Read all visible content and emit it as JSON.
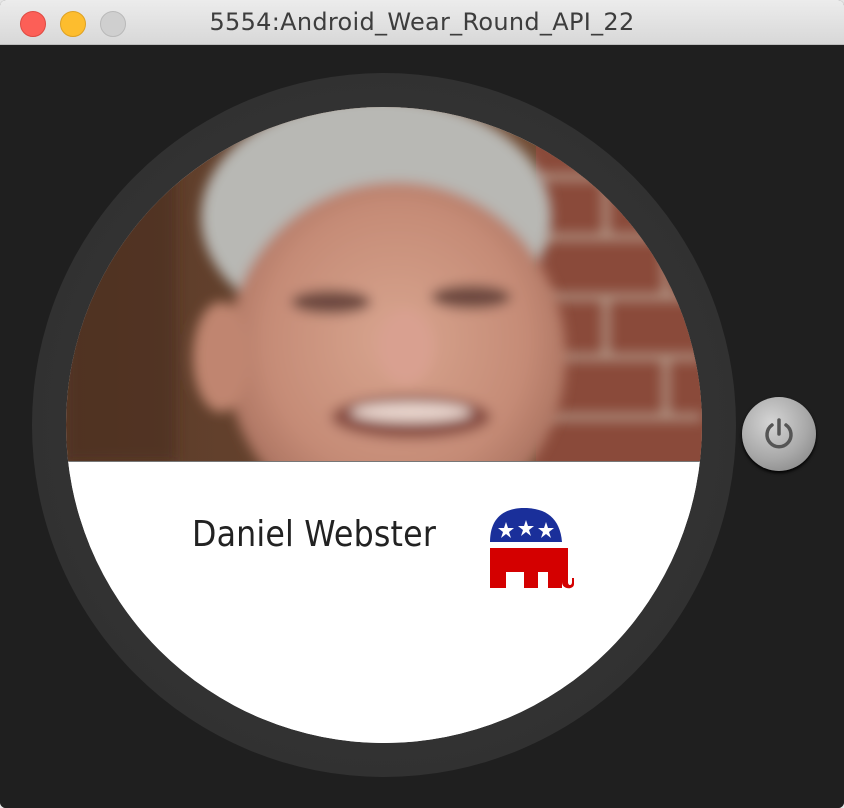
{
  "window": {
    "title": "5554:Android_Wear_Round_API_22",
    "controls": [
      "close",
      "minimize",
      "zoom"
    ]
  },
  "watch_screen": {
    "contact_name": "Daniel Webster",
    "photo": "portrait-photo",
    "party_icon": "republican-elephant-icon"
  },
  "side_button": {
    "icon": "power-icon"
  },
  "colors": {
    "bezel": "#2e2e2e",
    "background": "#1f1f1f",
    "elephant_blue": "#1a2f9a",
    "elephant_red": "#d40000"
  }
}
